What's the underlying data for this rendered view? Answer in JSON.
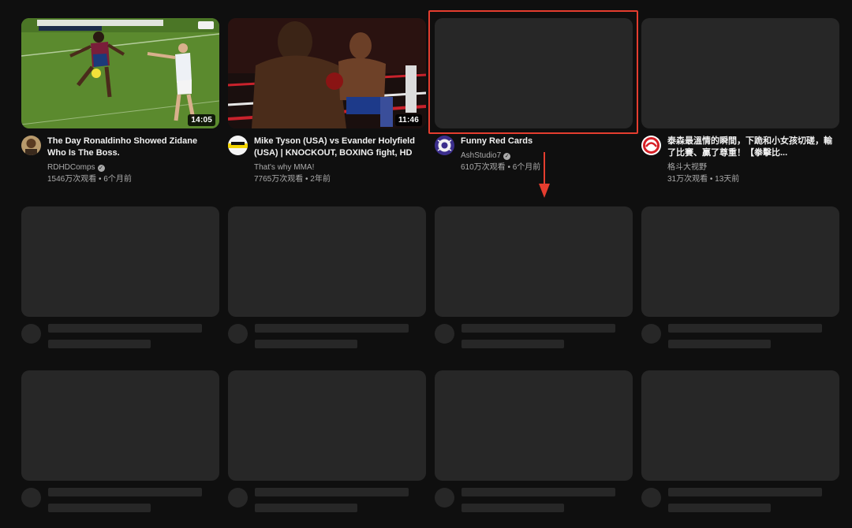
{
  "videos": [
    {
      "title": "The Day Ronaldinho Showed Zidane Who Is The Boss.",
      "channel": "RDHDComps",
      "stats": "1546万次观看 • 6个月前",
      "duration": "14:05",
      "verified": true
    },
    {
      "title": "Mike Tyson (USA) vs Evander Holyfield (USA) | KNOCKOUT, BOXING fight, HD",
      "channel": "That's why MMA!",
      "stats": "7765万次观看 • 2年前",
      "duration": "11:46",
      "verified": false
    },
    {
      "title": "Funny Red Cards",
      "channel": "AshStudio7",
      "stats": "610万次观看 • 6个月前",
      "duration": "",
      "verified": true
    },
    {
      "title": "泰森最溫情的瞬間，下跪和小女孩切磋，輸了比賽、贏了尊重！【拳擊比...",
      "channel": "格斗大视野",
      "stats": "31万次观看 • 13天前",
      "duration": "",
      "verified": false
    }
  ],
  "annotation": {
    "color": "#e53d2f"
  },
  "colors": {
    "background": "#0f0f0f",
    "skeleton": "#272727",
    "text_primary": "#f1f1f1",
    "text_secondary": "#aaaaaa"
  }
}
